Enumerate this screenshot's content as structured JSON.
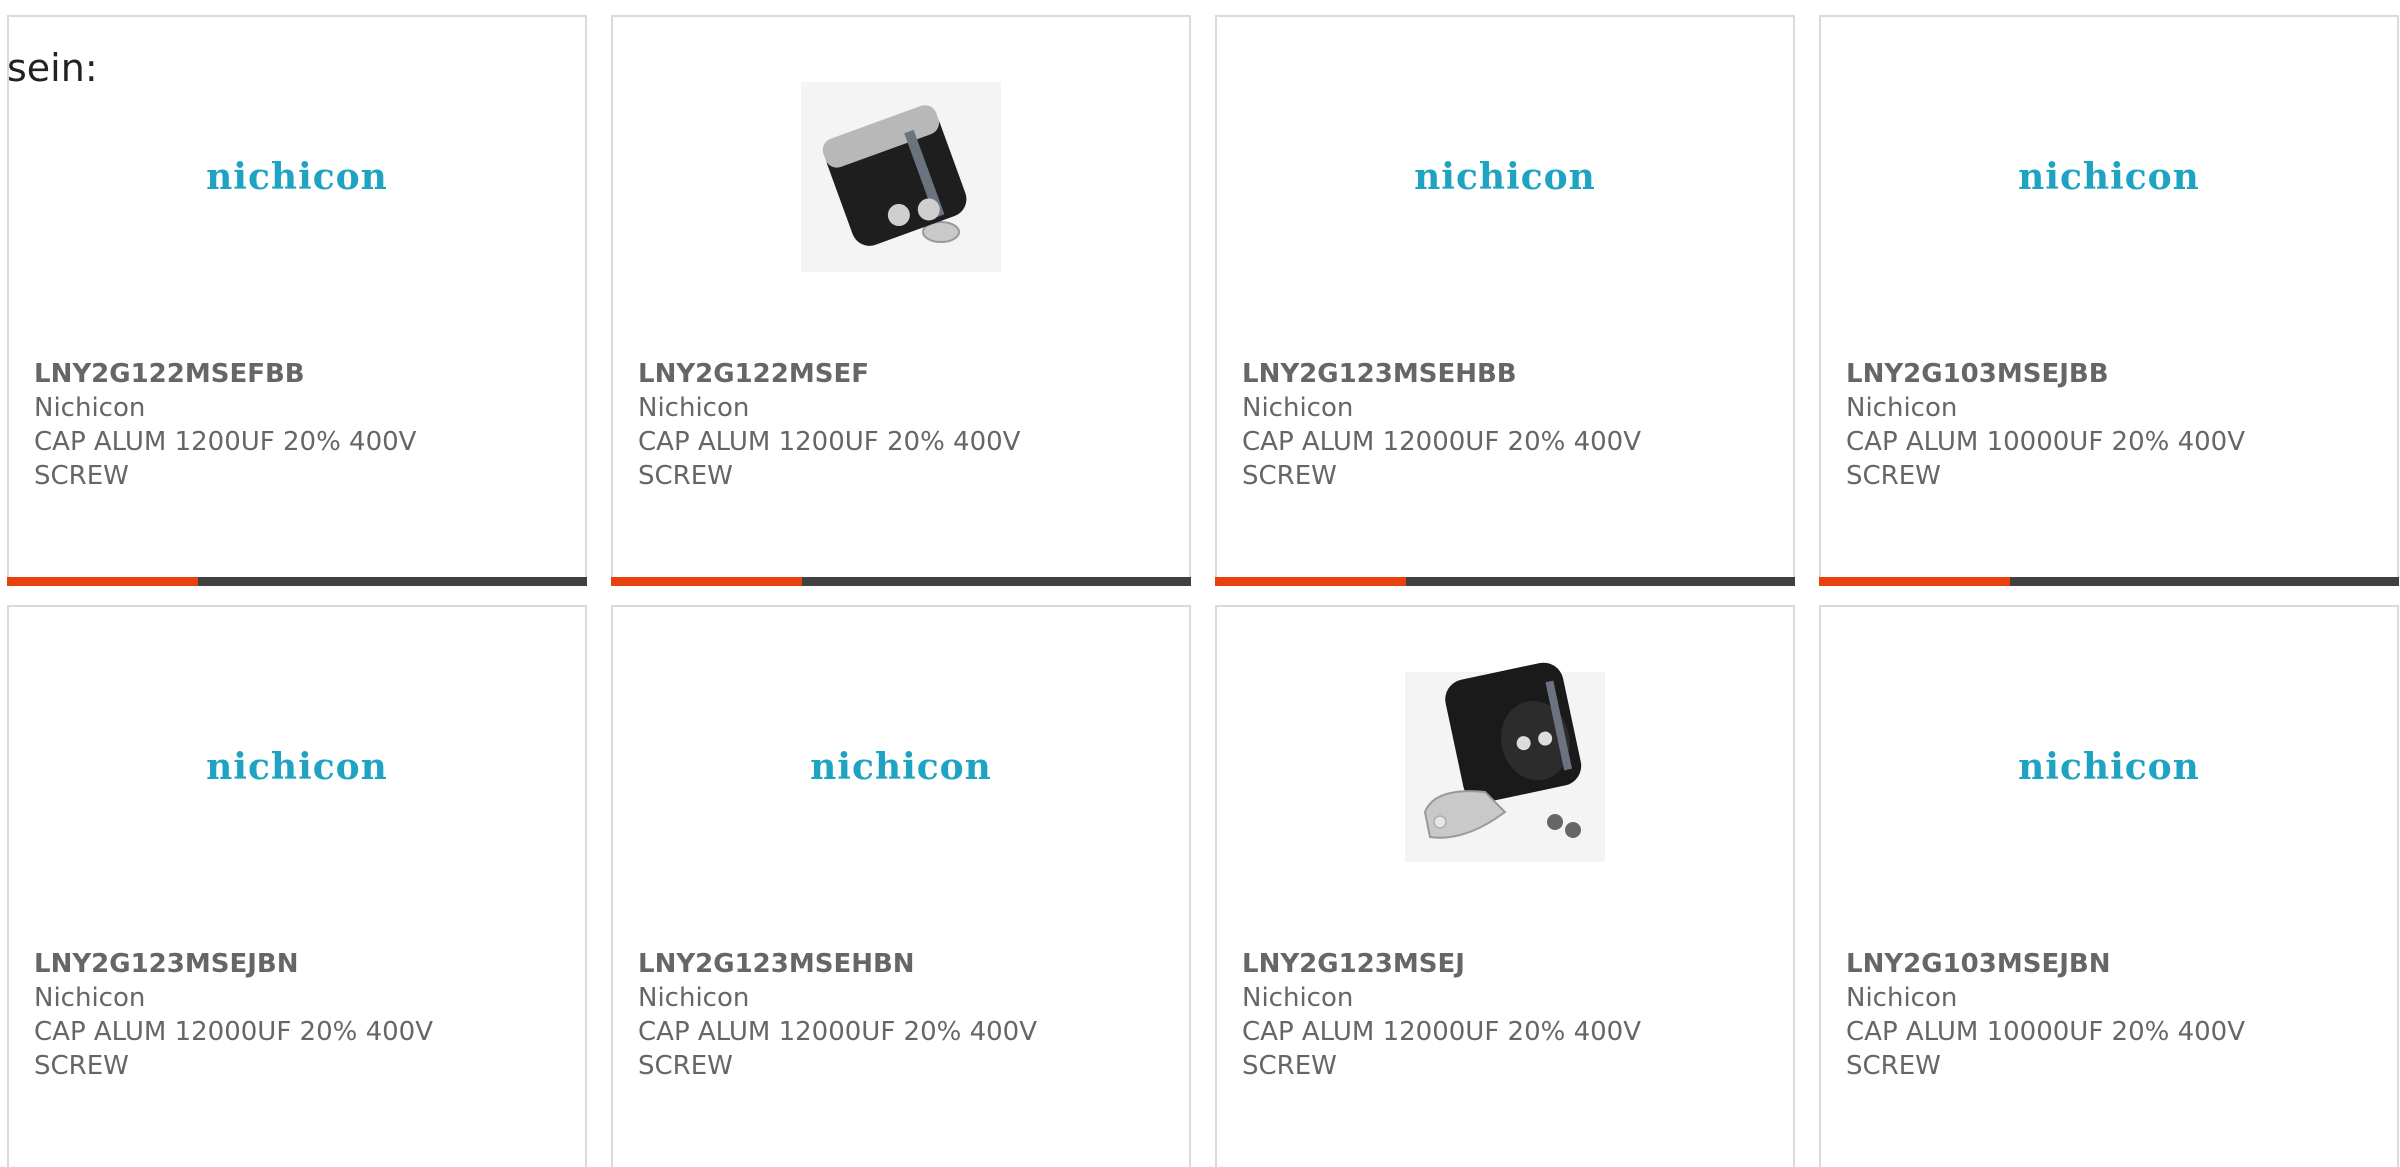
{
  "header_text": "sein:",
  "colors": {
    "accent": "#e8410d",
    "bar_track": "#404040",
    "brand": "#1fa3c2",
    "text": "#666666"
  },
  "cards": [
    {
      "part": "LNY2G122MSEFBB",
      "maker": "Nichicon",
      "desc_line1": "CAP ALUM 1200UF 20% 400V",
      "desc_line2": "SCREW",
      "image": "logo",
      "logo_text": "nichicon",
      "progress": 0.33
    },
    {
      "part": "LNY2G122MSEF",
      "maker": "Nichicon",
      "desc_line1": "CAP ALUM 1200UF 20% 400V",
      "desc_line2": "SCREW",
      "image": "capacitor-photo-1",
      "logo_text": "",
      "progress": 0.33
    },
    {
      "part": "LNY2G123MSEHBB",
      "maker": "Nichicon",
      "desc_line1": "CAP ALUM 12000UF 20% 400V",
      "desc_line2": "SCREW",
      "image": "logo",
      "logo_text": "nichicon",
      "progress": 0.33
    },
    {
      "part": "LNY2G103MSEJBB",
      "maker": "Nichicon",
      "desc_line1": "CAP ALUM 10000UF 20% 400V",
      "desc_line2": "SCREW",
      "image": "logo",
      "logo_text": "nichicon",
      "progress": 0.33
    },
    {
      "part": "LNY2G123MSEJBN",
      "maker": "Nichicon",
      "desc_line1": "CAP ALUM 12000UF 20% 400V",
      "desc_line2": "SCREW",
      "image": "logo",
      "logo_text": "nichicon"
    },
    {
      "part": "LNY2G123MSEHBN",
      "maker": "Nichicon",
      "desc_line1": "CAP ALUM 12000UF 20% 400V",
      "desc_line2": "SCREW",
      "image": "logo",
      "logo_text": "nichicon"
    },
    {
      "part": "LNY2G123MSEJ",
      "maker": "Nichicon",
      "desc_line1": "CAP ALUM 12000UF 20% 400V",
      "desc_line2": "SCREW",
      "image": "capacitor-photo-2",
      "logo_text": ""
    },
    {
      "part": "LNY2G103MSEJBN",
      "maker": "Nichicon",
      "desc_line1": "CAP ALUM 10000UF 20% 400V",
      "desc_line2": "SCREW",
      "image": "logo",
      "logo_text": "nichicon"
    }
  ]
}
